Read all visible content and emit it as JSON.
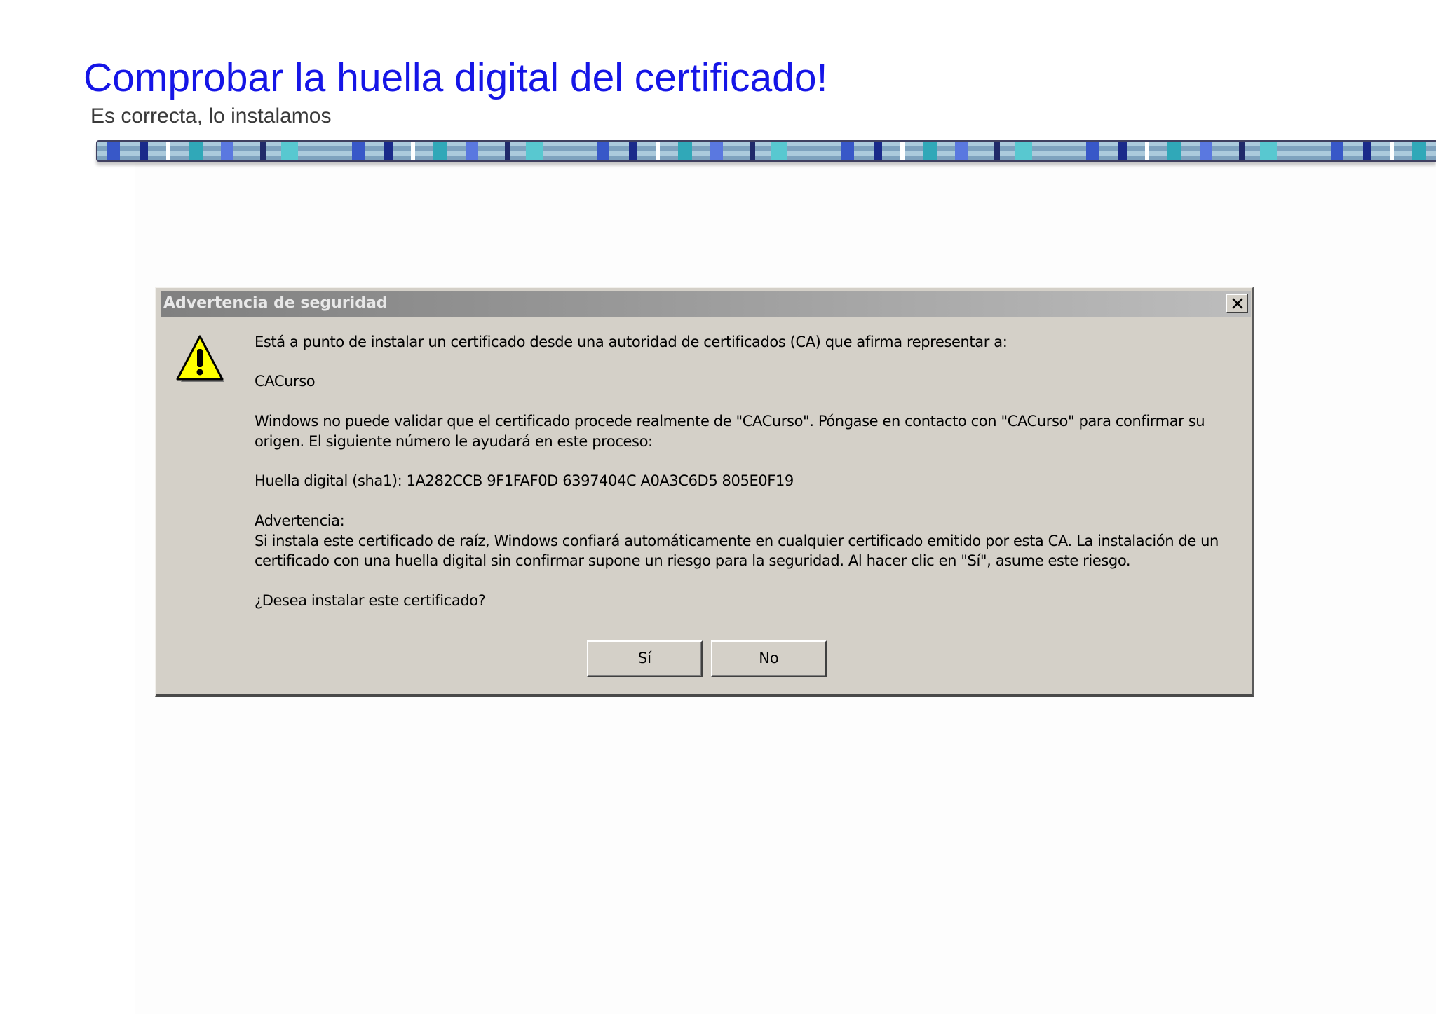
{
  "slide": {
    "title": "Comprobar la huella digital del certificado!",
    "subtitle": "Es correcta, lo instalamos"
  },
  "dialog": {
    "title": "Advertencia de seguridad",
    "icon": "warning-icon",
    "line_intro": "Está a punto de instalar un certificado desde una autoridad de certificados (CA) que afirma representar a:",
    "ca_name": "CACurso",
    "validation_line1": "Windows no puede validar que el certificado procede realmente de \"CACurso\". Póngase en contacto con \"CACurso\" para confirmar su",
    "validation_line2": "origen. El siguiente número le ayudará en este proceso:",
    "thumbprint": "Huella digital (sha1): 1A282CCB 9F1FAF0D 6397404C A0A3C6D5 805E0F19",
    "warning_heading": "Advertencia:",
    "warning_line1": "Si instala este certificado de raíz, Windows confiará automáticamente en cualquier certificado emitido por esta CA. La instalación de un",
    "warning_line2": "certificado con una huella digital sin confirmar supone un riesgo para la seguridad. Al hacer clic en \"Sí\", asume este riesgo.",
    "question": "¿Desea instalar este certificado?",
    "yes_label": "Sí",
    "no_label": "No"
  },
  "colors": {
    "title": "#1515e6",
    "dialog_face": "#d4d0c8",
    "icon_yellow": "#ffff00"
  }
}
